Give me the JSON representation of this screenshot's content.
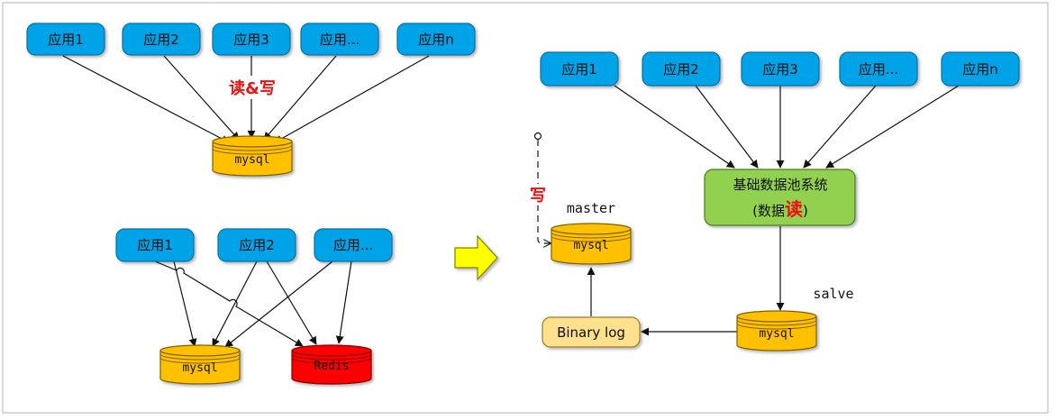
{
  "left_top": {
    "apps": [
      "应用1",
      "应用2",
      "应用3",
      "应用...",
      "应用n"
    ],
    "annotation": "读&写",
    "db": "mysql"
  },
  "left_bottom": {
    "apps": [
      "应用1",
      "应用2",
      "应用..."
    ],
    "db_mysql": "mysql",
    "db_redis": "Redis"
  },
  "right": {
    "apps": [
      "应用1",
      "应用2",
      "应用3",
      "应用...",
      "应用n"
    ],
    "pool_title": "基础数据池系统",
    "pool_sub_prefix": "(数据",
    "pool_sub_emph": "读",
    "pool_sub_suffix": ")",
    "write_label": "写",
    "master_label": "master",
    "master_db": "mysql",
    "slave_label": "salve",
    "slave_db": "mysql",
    "binlog_label": "Binary log"
  },
  "colors": {
    "app_fill": "#00a3e8",
    "db_yellow": "#ffc000",
    "db_red": "#ff0000",
    "pool_green": "#92d050",
    "binlog_fill": "#ffe08c",
    "accent_red": "#ee1111"
  }
}
